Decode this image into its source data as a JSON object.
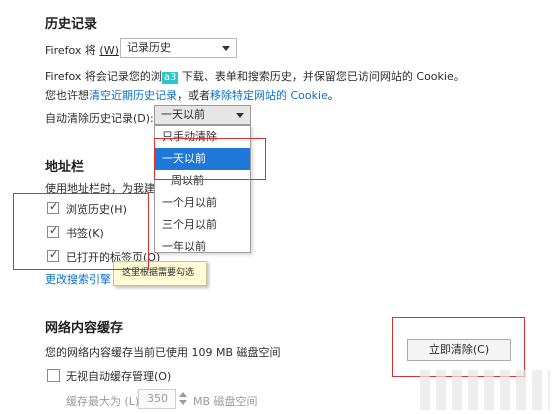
{
  "history": {
    "title": "历史记录",
    "firefox_will_prefix": "Firefox 将",
    "firefox_will_key": "(W)",
    "mode_select_value": "记录历史",
    "desc_line1_a": "Firefox 将会记录您的浏",
    "desc_badge": "a3",
    "desc_line1_b": "下载、表单和搜索历史，并保留您已访问网站的 Cookie。",
    "desc_line2_a": "您也许想",
    "desc_line2_link1": "清空近期历史记录",
    "desc_line2_mid": "，或者",
    "desc_line2_link2": "移除特定网站的 Cookie",
    "desc_line2_end": "。",
    "auto_clear_label": "自动清除历史记录(D):",
    "auto_clear_value": "一天以前",
    "dropdown_options": [
      "只手动清除",
      "一天以前",
      "周以前",
      "一个月以前",
      "三个月以前",
      "一年以前"
    ],
    "dropdown_selected_index": 1
  },
  "address_bar": {
    "title": "地址栏",
    "desc": "使用地址栏时，为我建",
    "items": [
      {
        "label": "浏览历史(H)",
        "checked": true
      },
      {
        "label": "书签(K)",
        "checked": true
      },
      {
        "label": "已打开的标签页(O)",
        "checked": true
      }
    ],
    "change_search_link": "更改搜索引擎"
  },
  "tooltip": {
    "text": "这里根据需要勾选"
  },
  "cache": {
    "title": "网络内容缓存",
    "usage_text": "您的网络内容缓存当前已使用 109 MB 磁盘空间",
    "clear_button": "立即清除(C)",
    "override_label": "无视自动缓存管理(O)",
    "limit_label": "缓存最大为 (L)",
    "limit_value": "350",
    "limit_unit": "MB 磁盘空间"
  },
  "colors": {
    "link": "#0a6ecf",
    "selection": "#1e78d7",
    "annotation_red": "#d8312e",
    "tooltip_bg": "#fffbd4"
  }
}
